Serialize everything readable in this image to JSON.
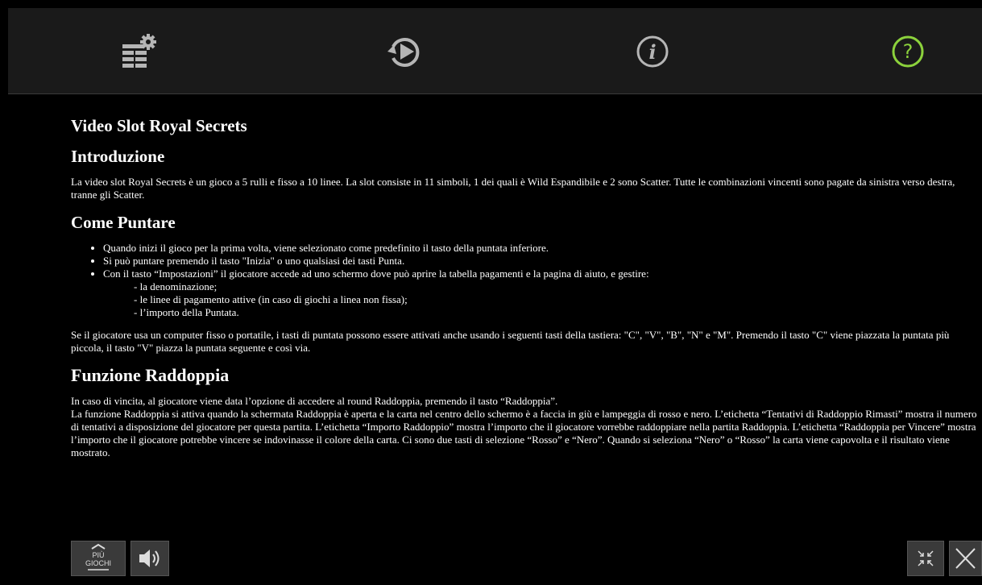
{
  "toolbar": {
    "icons": [
      "settings-menu-icon",
      "replay-icon",
      "info-icon",
      "help-icon"
    ],
    "help_color": "#8cd23c",
    "icon_color": "#b5b5b5"
  },
  "content": {
    "title": "Video Slot Royal Secrets",
    "intro_heading": "Introduzione",
    "intro_text": "La video slot Royal Secrets è un gioco a 5 rulli e fisso a 10 linee. La slot consiste in 11 simboli, 1 dei quali è Wild Espandibile e 2 sono Scatter. Tutte le combinazioni vincenti sono pagate da sinistra verso destra, tranne gli Scatter.",
    "bet_heading": "Come Puntare",
    "bet_items": [
      "Quando inizi il gioco per la prima volta, viene selezionato come predefinito il tasto della puntata inferiore.",
      "Si può puntare premendo il tasto \"Inizia\" o uno qualsiasi dei tasti Punta.",
      "Con il tasto “Impostazioni” il giocatore accede ad uno schermo dove può aprire la tabella pagamenti e la pagina di aiuto, e gestire:"
    ],
    "bet_subitems": [
      "- la denominazione;",
      "- le linee di pagamento attive (in caso di giochi a linea non fissa);",
      "- l’importo della Puntata."
    ],
    "keyboard_text": "Se il giocatore usa un computer fisso o portatile, i tasti di puntata possono essere attivati anche usando i seguenti tasti della tastiera: \"C\", \"V\", \"B\", \"N\" e \"M\". Premendo il tasto \"C\" viene piazzata la puntata più piccola, il tasto \"V\" piazza la puntata seguente e così via.",
    "double_heading": "Funzione Raddoppia",
    "double_line1": "In caso di vincita, al giocatore viene data l’opzione di accedere al round Raddoppia, premendo il tasto “Raddoppia”.",
    "double_text": "La funzione Raddoppia si attiva quando la schermata Raddoppia è aperta e la carta nel centro dello schermo è a faccia in giù e lampeggia di rosso e nero. L’etichetta “Tentativi di Raddoppio Rimasti” mostra il numero di tentativi a disposizione del giocatore per questa partita. L’etichetta “Importo Raddoppio” mostra l’importo che il giocatore vorrebbe raddoppiare nella partita Raddoppia. L’etichetta “Raddoppia per Vincere” mostra l’importo che il giocatore potrebbe vincere se indovinasse il colore della carta. Ci sono due tasti di selezione “Rosso” e “Nero”. Quando si seleziona “Nero” o “Rosso” la carta viene capovolta e il risultato viene mostrato."
  },
  "bottom": {
    "more_games_line1": "PIÙ",
    "more_games_line2": "GIOCHI"
  }
}
